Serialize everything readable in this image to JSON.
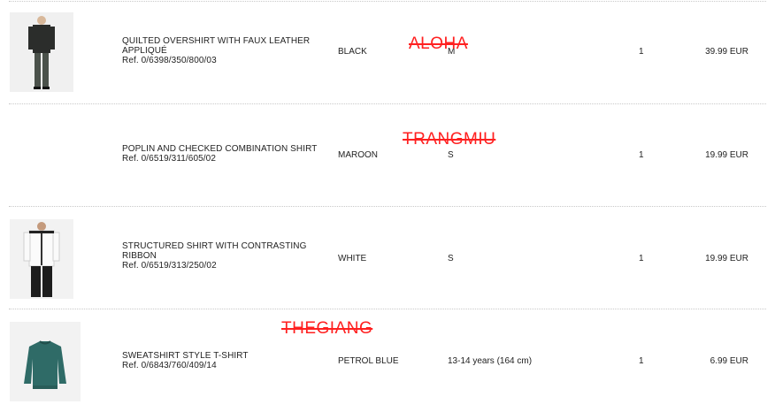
{
  "items": [
    {
      "name_line1": "QUILTED OVERSHIRT WITH FAUX LEATHER",
      "name_line2": "APPLIQUÉ",
      "ref": "Ref. 0/6398/350/800/03",
      "color": "BLACK",
      "size": "M",
      "qty": "1",
      "price": "39.99 EUR"
    },
    {
      "name_line1": "POPLIN AND CHECKED COMBINATION SHIRT",
      "name_line2": "",
      "ref": "Ref. 0/6519/311/605/02",
      "color": "MAROON",
      "size": "S",
      "qty": "1",
      "price": "19.99 EUR"
    },
    {
      "name_line1": "STRUCTURED SHIRT WITH CONTRASTING",
      "name_line2": "RIBBON",
      "ref": "Ref. 0/6519/313/250/02",
      "color": "WHITE",
      "size": "S",
      "qty": "1",
      "price": "19.99 EUR"
    },
    {
      "name_line1": "SWEATSHIRT STYLE T-SHIRT",
      "name_line2": "",
      "ref": "Ref. 0/6843/760/409/14",
      "color": "PETROL BLUE",
      "size": "13-14 years (164 cm)",
      "qty": "1",
      "price": "6.99 EUR"
    }
  ],
  "overlays": {
    "stamp_1": "ALOHA",
    "stamp_2": "TRANGMIU",
    "stamp_3": "THEGIANG"
  },
  "colors": {
    "stamp": "#ff2020",
    "separator": "#c9c9c9"
  }
}
